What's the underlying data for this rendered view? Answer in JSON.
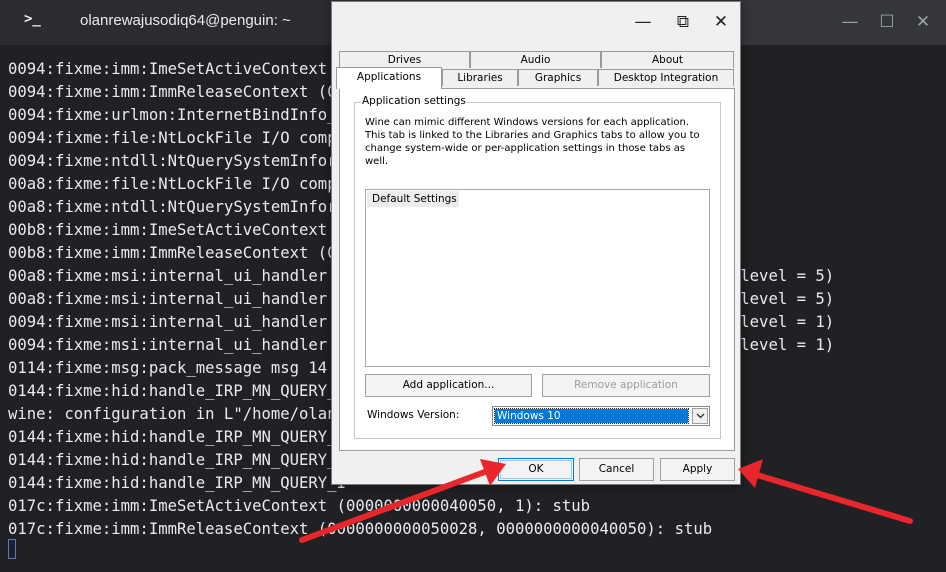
{
  "terminal": {
    "icon": ">_",
    "tab_title": "olanrewajusodiq64@penguin: ~",
    "window_controls": {
      "minimize": "—",
      "maximize": "☐",
      "close": "✕"
    },
    "lines": [
      "0094:fixme:imm:ImeSetActiveContext (",
      "0094:fixme:imm:ImmReleaseContext (00",
      "0094:fixme:urlmon:InternetBindInfo_G",
      "0094:fixme:file:NtLockFile I/O compl",
      "0094:fixme:ntdll:NtQuerySystemInform                                  ON",
      "00a8:fixme:file:NtLockFile I/O compl",
      "00a8:fixme:ntdll:NtQuerySystemInform                                  ON",
      "00b8:fixme:imm:ImeSetActiveContext (",
      "00b8:fixme:imm:ImmReleaseContext (00",
      "00a8:fixme:msi:internal_ui_handler i                                 0000 (UI level = 5)",
      "00a8:fixme:msi:internal_ui_handler i                                 0000 (UI level = 5)",
      "0094:fixme:msi:internal_ui_handler i                                 0000 (UI level = 1)",
      "0094:fixme:msi:internal_ui_handler i                                 0000 (UI level = 1)",
      "0114:fixme:msg:pack_message msg 14 (",
      "0144:fixme:hid:handle_IRP_MN_QUERY_I",
      "wine: configuration in L\"/home/olanr",
      "0144:fixme:hid:handle_IRP_MN_QUERY_I",
      "0144:fixme:hid:handle_IRP_MN_QUERY_I",
      "0144:fixme:hid:handle_IRP_MN_QUERY_I",
      "017c:fixme:imm:ImeSetActiveContext (0000000000040050, 1): stub",
      "017c:fixme:imm:ImmReleaseContext (0000000000050028, 0000000000040050): stub"
    ]
  },
  "dialog": {
    "window_controls": {
      "minimize": "—",
      "restore": "⧉",
      "close": "✕"
    },
    "tabs_top": [
      "Drives",
      "Audio",
      "About"
    ],
    "tabs_bottom": [
      "Applications",
      "Libraries",
      "Graphics",
      "Desktop Integration"
    ],
    "active_tab": "Applications",
    "group_title": "Application settings",
    "description": "Wine can mimic different Windows versions for each application. This tab is linked to the Libraries and Graphics tabs to allow you to change system-wide or per-application settings in those tabs as well.",
    "app_list": [
      "Default Settings"
    ],
    "add_application": "Add application...",
    "remove_application": "Remove application",
    "windows_version_label": "Windows Version:",
    "windows_version_value": "Windows 10",
    "ok": "OK",
    "cancel": "Cancel",
    "apply": "Apply"
  },
  "colors": {
    "terminal_bg": "#202124",
    "annotation_arrow": "#e8262b",
    "selection": "#0078d7"
  }
}
